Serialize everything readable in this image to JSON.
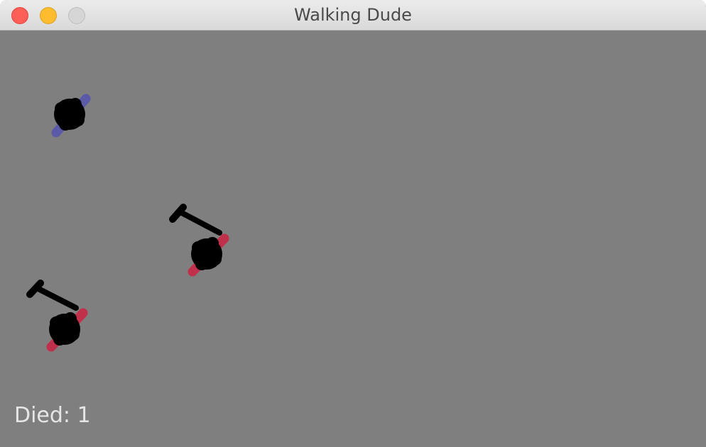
{
  "window": {
    "title": "Walking Dude"
  },
  "hud": {
    "died_text": "Died: 1"
  },
  "colors": {
    "background": "#7f7f7f",
    "player_feet": "#5a5aa8",
    "enemy_feet": "#c0304a",
    "body": "#000000"
  },
  "entities": [
    {
      "kind": "player",
      "armed": false
    },
    {
      "kind": "enemy",
      "armed": true,
      "weapon": "hammer"
    },
    {
      "kind": "enemy",
      "armed": true,
      "weapon": "hammer"
    }
  ]
}
